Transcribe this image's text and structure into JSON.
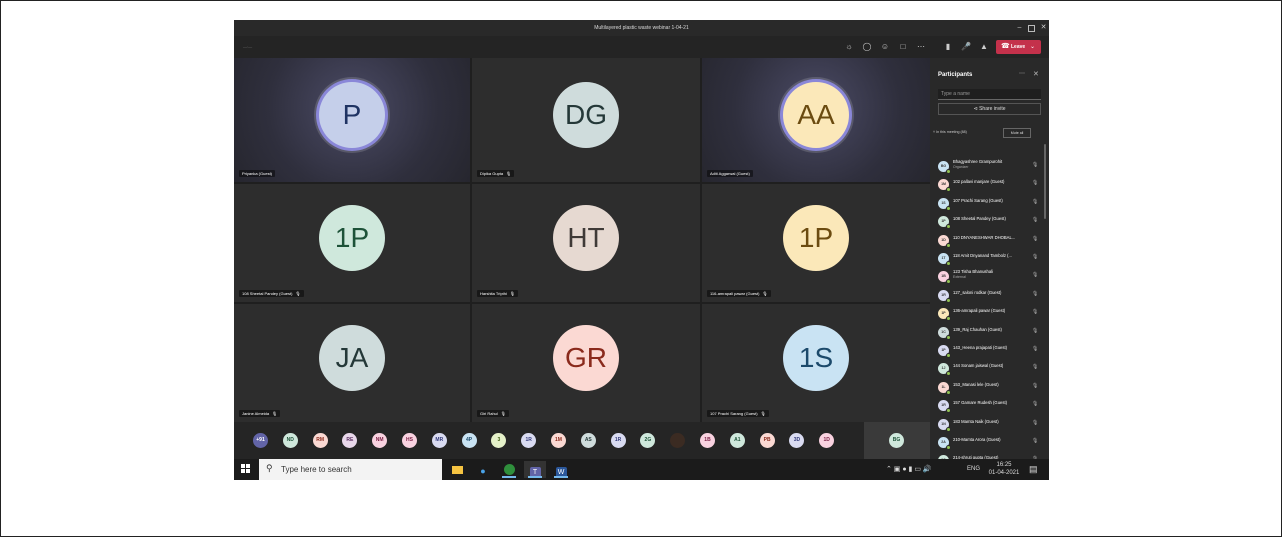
{
  "window": {
    "title": "Multilayered plastic waste webinar 1-04-21"
  },
  "toolbar": {
    "timer": "—:—",
    "leave_label": "Leave"
  },
  "tiles": [
    {
      "initials": "P",
      "name": "Priyanka (Guest)",
      "bg": "#c5cfea",
      "fg": "#1f3363",
      "active": true
    },
    {
      "initials": "DG",
      "name": "Dipika Gupta",
      "bg": "#cfdcdc",
      "fg": "#243838",
      "active": false
    },
    {
      "initials": "AA",
      "name": "Aditi Aggarwal (Guest)",
      "bg": "#fbe8b9",
      "fg": "#6b4b10",
      "active": true
    },
    {
      "initials": "1P",
      "name": "108 Sheetal Pandey (Guest)",
      "bg": "#cfe8dc",
      "fg": "#1d5238",
      "active": false
    },
    {
      "initials": "HT",
      "name": "Harshita Tripthi",
      "bg": "#e6d9d1",
      "fg": "#3f3a37",
      "active": false
    },
    {
      "initials": "1P",
      "name": "116-amrapali pawar (Guest)",
      "bg": "#fbe8b9",
      "fg": "#6b4b10",
      "active": false
    },
    {
      "initials": "JA",
      "name": "Janine Almeida",
      "bg": "#cfdcdc",
      "fg": "#243838",
      "active": false
    },
    {
      "initials": "GR",
      "name": "Giri Rahul",
      "bg": "#fbd9d3",
      "fg": "#8a2a1c",
      "active": false
    },
    {
      "initials": "1S",
      "name": "107 Prachi Sarang (Guest)",
      "bg": "#c9e3f3",
      "fg": "#1c4a6b",
      "active": false
    }
  ],
  "strip": [
    {
      "t": "+91",
      "bg": "#6264a7",
      "fg": "#ffffff"
    },
    {
      "t": "ND",
      "bg": "#cfe8dc",
      "fg": "#1d5238"
    },
    {
      "t": "RM",
      "bg": "#fbd9d3",
      "fg": "#8a2a1c"
    },
    {
      "t": "RE",
      "bg": "#e8d7ea",
      "fg": "#5a2e60"
    },
    {
      "t": "NM",
      "bg": "#f9d2e0",
      "fg": "#7a1f44"
    },
    {
      "t": "HS",
      "bg": "#f9d2e0",
      "fg": "#7a1f44"
    },
    {
      "t": "MR",
      "bg": "#d9dbf1",
      "fg": "#333a7a"
    },
    {
      "t": "4P",
      "bg": "#c9e3f3",
      "fg": "#1c4a6b"
    },
    {
      "t": "3",
      "bg": "#e5f1c9",
      "fg": "#3e5a12"
    },
    {
      "t": "1R",
      "bg": "#d9dbf1",
      "fg": "#333a7a"
    },
    {
      "t": "1M",
      "bg": "#fbd9d3",
      "fg": "#8a2a1c"
    },
    {
      "t": "AS",
      "bg": "#cfdcdc",
      "fg": "#243838"
    },
    {
      "t": "1R",
      "bg": "#d9dbf1",
      "fg": "#333a7a"
    },
    {
      "t": "2G",
      "bg": "#cfe8dc",
      "fg": "#1d5238"
    },
    {
      "t": "",
      "bg": "#3b2b22",
      "fg": "#ffffff"
    },
    {
      "t": "1B",
      "bg": "#f9d2e0",
      "fg": "#7a1f44"
    },
    {
      "t": "A1",
      "bg": "#cfe8dc",
      "fg": "#1d5238"
    },
    {
      "t": "PB",
      "bg": "#fbd9d3",
      "fg": "#8a2a1c"
    },
    {
      "t": "3D",
      "bg": "#d9dbf1",
      "fg": "#333a7a"
    },
    {
      "t": "1D",
      "bg": "#f9d2e0",
      "fg": "#7a1f44"
    }
  ],
  "self_initials": "BG",
  "panel": {
    "title": "Participants",
    "search_placeholder": "Type a name",
    "share_label": "Share invite",
    "section_label": "In this meeting (88)",
    "mute_all": "Mute all",
    "participants": [
      {
        "name": "Bhagyashree Grampurohit",
        "sub": "Organizer",
        "initials": "BG",
        "bg": "#c9e3f3"
      },
      {
        "name": "102 pallavi manjare (Guest)",
        "sub": "",
        "initials": "1M",
        "bg": "#fbd9d3"
      },
      {
        "name": "107 Prachi Sarang (Guest)",
        "sub": "",
        "initials": "1S",
        "bg": "#c9e3f3"
      },
      {
        "name": "108 Sheetal Pandey (Guest)",
        "sub": "",
        "initials": "1P",
        "bg": "#cfe8dc"
      },
      {
        "name": "110 DNYANESHWAR DHOBAL...",
        "sub": "",
        "initials": "1D",
        "bg": "#fbd9d3"
      },
      {
        "name": "118 Amit Dnyanand Tambolz (...",
        "sub": "",
        "initials": "1T",
        "bg": "#c9e3f3"
      },
      {
        "name": "123 Tisha Bhanushali",
        "sub": "External",
        "initials": "1B",
        "bg": "#f9d2e0"
      },
      {
        "name": "127_saloni rodkar (Guest)",
        "sub": "",
        "initials": "1R",
        "bg": "#d9dbf1"
      },
      {
        "name": "136-amrapali pawar (Guest)",
        "sub": "",
        "initials": "1P",
        "bg": "#fbe8b9"
      },
      {
        "name": "139_Raj Chauhan (Guest)",
        "sub": "",
        "initials": "1C",
        "bg": "#cfdcdc"
      },
      {
        "name": "143_Heena prajapati (Guest)",
        "sub": "",
        "initials": "1P",
        "bg": "#d9dbf1"
      },
      {
        "name": "144 Sonam jaiswal (Guest)",
        "sub": "",
        "initials": "1J",
        "bg": "#cfe8dc"
      },
      {
        "name": "153_Manasi lele (Guest)",
        "sub": "",
        "initials": "1L",
        "bg": "#fbd9d3"
      },
      {
        "name": "157 Gamare Rudesh (Guest)",
        "sub": "",
        "initials": "1R",
        "bg": "#d9dbf1"
      },
      {
        "name": "183 Mamta Naik (Guest)",
        "sub": "",
        "initials": "1N",
        "bg": "#d9dbf1"
      },
      {
        "name": "210-Mamta Arora (Guest)",
        "sub": "",
        "initials": "2A",
        "bg": "#c9e3f3"
      },
      {
        "name": "214-shruti gupta (Guest)",
        "sub": "",
        "initials": "2G",
        "bg": "#cfe8dc"
      }
    ]
  },
  "taskbar": {
    "search_placeholder": "Type here to search",
    "lang": "ENG",
    "time": "16:25",
    "date": "01-04-2021"
  }
}
